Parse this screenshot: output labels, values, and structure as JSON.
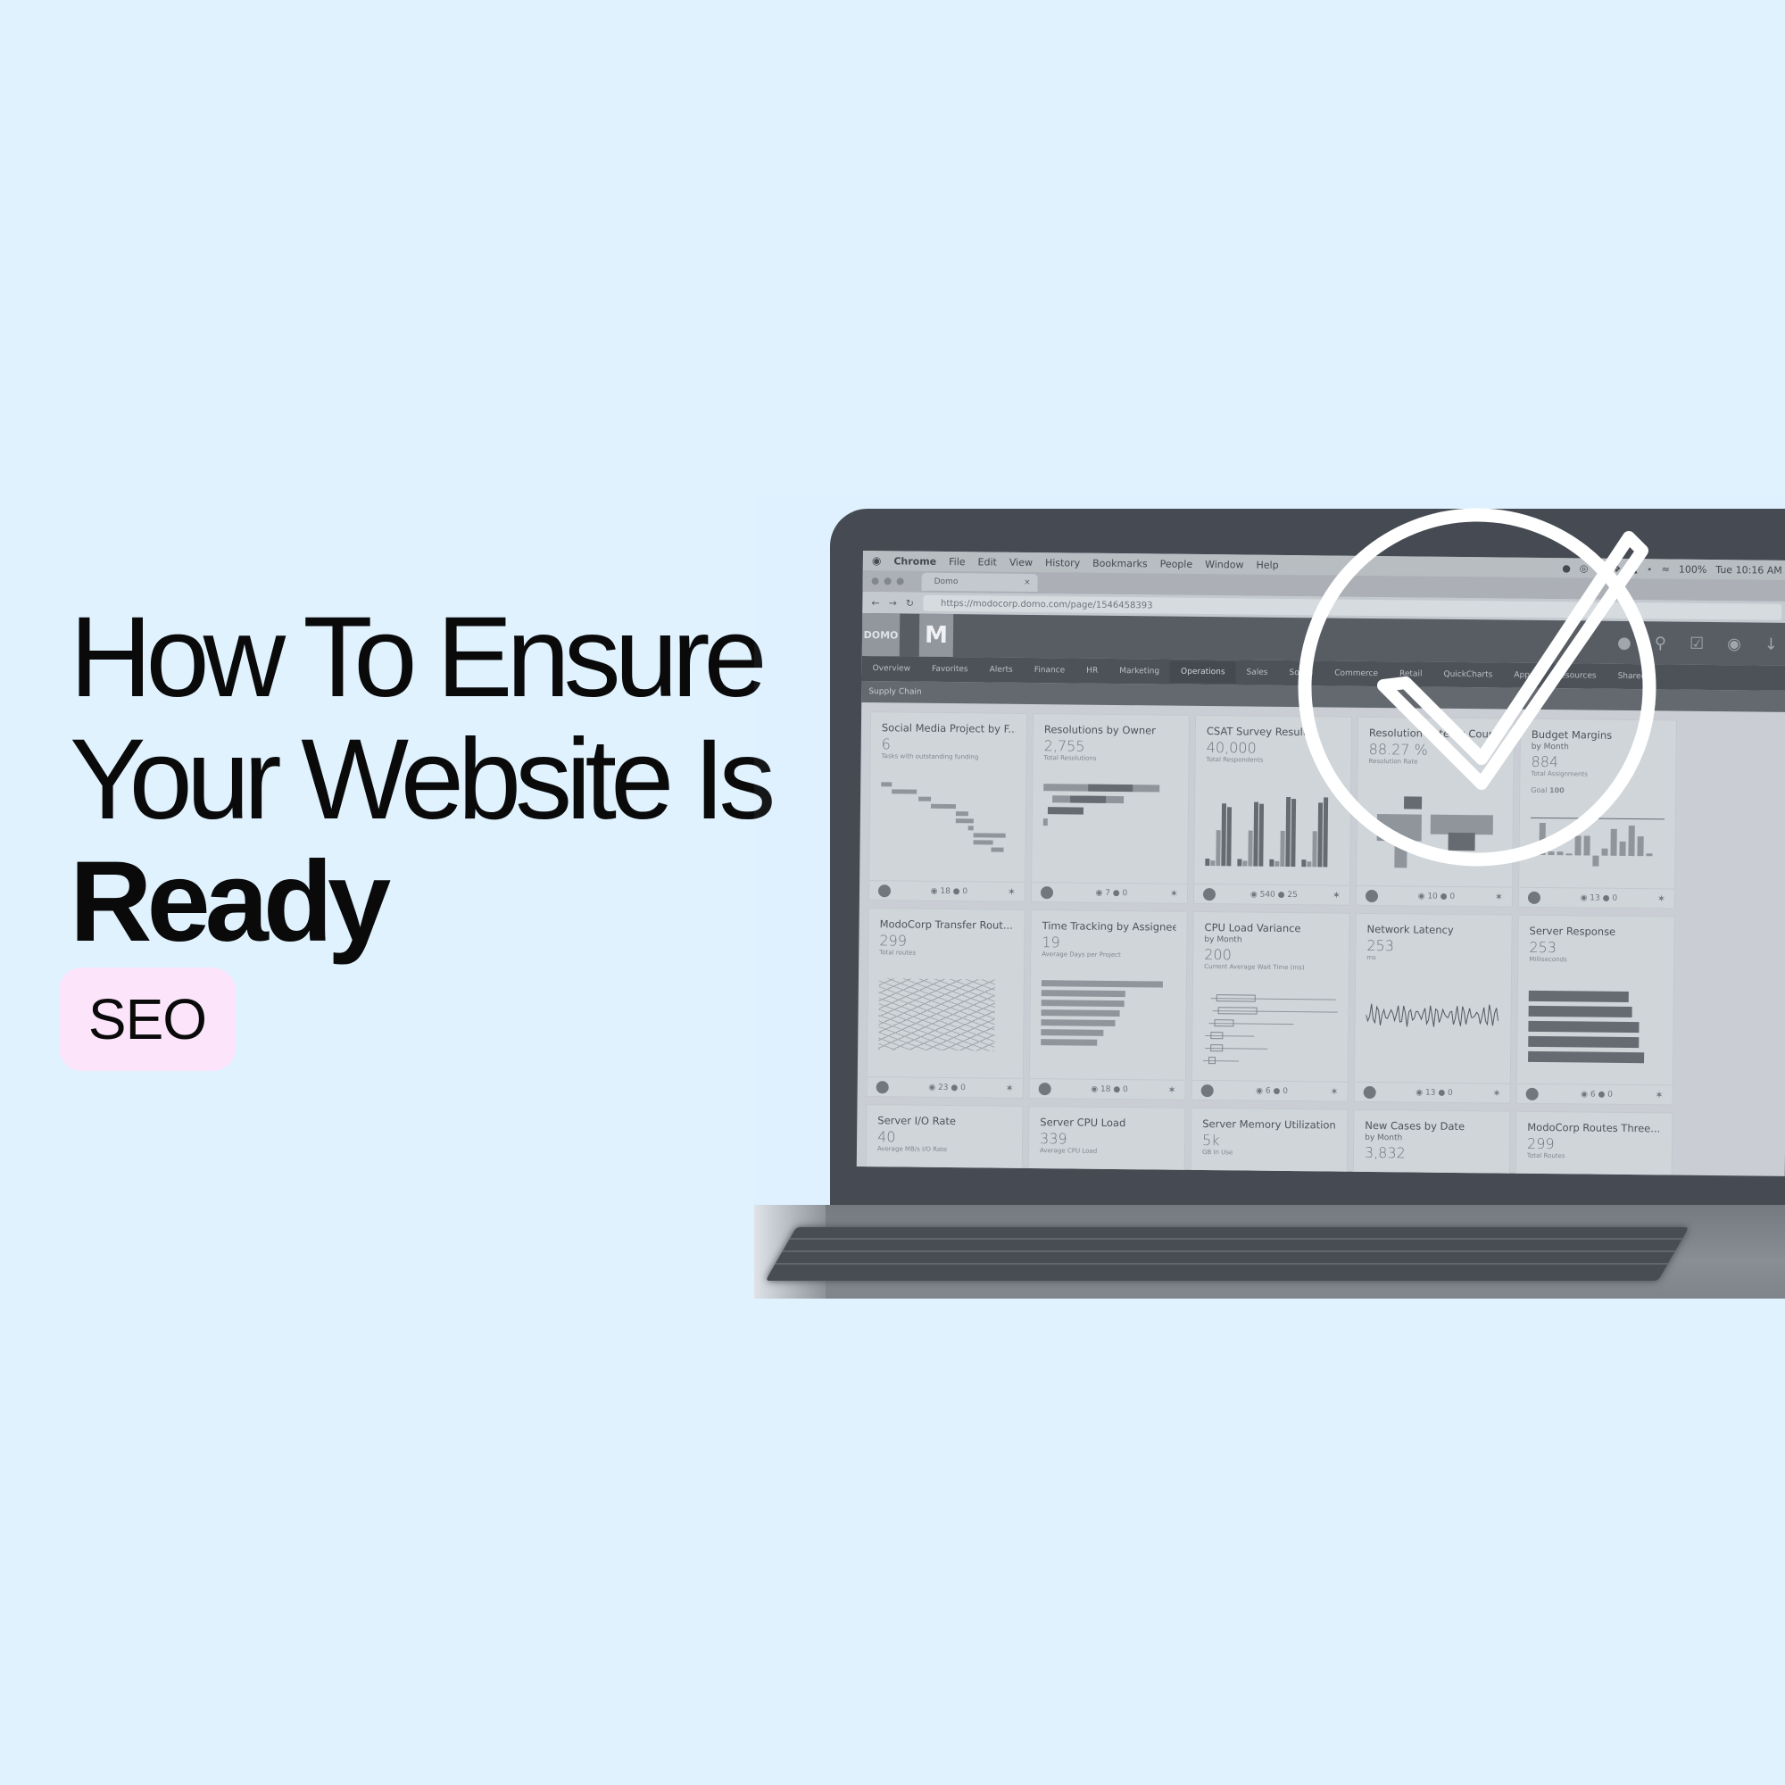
{
  "headline": {
    "line1": "How To Ensure",
    "line2": "Your Website Is",
    "line3": "Ready"
  },
  "badge": {
    "label": "SEO"
  },
  "colors": {
    "background": "#e0f2fe",
    "badge_bg": "#fce4fb",
    "text": "#0a0a0a",
    "check_icon": "#ffffff"
  },
  "overlay_icon": "check-circle-icon",
  "laptop_screen": {
    "menu_bar": {
      "apple": "",
      "app": "Chrome",
      "items": [
        "File",
        "Edit",
        "View",
        "History",
        "Bookmarks",
        "People",
        "Window",
        "Help"
      ],
      "battery": "100%",
      "clock": "Tue 10:16 AM"
    },
    "browser": {
      "tab_title": "Domo",
      "tab_close": "×",
      "url": "https://modocorp.domo.com/page/1546458393"
    },
    "app_header": {
      "logo": "DOMO",
      "page_logo": "M",
      "icons": [
        "globe-icon",
        "search-icon",
        "checkbox-icon",
        "chat-icon",
        "download-icon"
      ]
    },
    "nav": [
      "Overview",
      "Favorites",
      "Alerts",
      "Finance",
      "HR",
      "Marketing",
      "Operations",
      "Sales",
      "Social",
      "Commerce",
      "Retail",
      "QuickCharts",
      "Apps",
      "Resources",
      "Shared"
    ],
    "active_nav": "Operations",
    "subnav": "Supply Chain",
    "cards": [
      {
        "title": "Social Media Project by F...",
        "subtitle": "",
        "value": "6",
        "label": "Tasks with outstanding funding",
        "views": "18",
        "comments": "0",
        "chart": "gantt"
      },
      {
        "title": "Resolutions by Owner",
        "subtitle": "",
        "value": "2,755",
        "label": "Total Resolutions",
        "views": "7",
        "comments": "0",
        "chart": "stacked-bars"
      },
      {
        "title": "CSAT Survey Results",
        "subtitle": "",
        "value": "40,000",
        "label": "Total Respondents",
        "views": "540",
        "comments": "25",
        "chart": "grouped-bars"
      },
      {
        "title": "Resolution Rate by Coun...",
        "subtitle": "",
        "value": "88.27 %",
        "label": "Resolution Rate",
        "views": "10",
        "comments": "0",
        "chart": "world-map"
      },
      {
        "title": "Budget Margins",
        "subtitle": "by Month",
        "value": "884",
        "label": "Total Assignments",
        "goal_label": "Goal",
        "goal_value": "100",
        "views": "13",
        "comments": "0",
        "chart": "bars-with-line"
      },
      {
        "title": "ModoCorp Transfer Rout...",
        "subtitle": "",
        "value": "299",
        "label": "Total routes",
        "views": "23",
        "comments": "0",
        "chart": "route-map"
      },
      {
        "title": "Time Tracking by Assignee",
        "subtitle": "",
        "value": "19",
        "label": "Average Days per Project",
        "views": "18",
        "comments": "0",
        "chart": "hbars"
      },
      {
        "title": "CPU Load Variance",
        "subtitle": "by Month",
        "value": "200",
        "label": "Current Average Wait Time (ms)",
        "views": "6",
        "comments": "0",
        "chart": "boxplot"
      },
      {
        "title": "Network Latency",
        "subtitle": "",
        "value": "253",
        "label": "ms",
        "views": "13",
        "comments": "0",
        "chart": "line"
      },
      {
        "title": "Server Response",
        "subtitle": "",
        "value": "253",
        "label": "Milliseconds",
        "views": "6",
        "comments": "0",
        "chart": "hbars-dark"
      },
      {
        "title": "Server I/O Rate",
        "subtitle": "",
        "value": "40",
        "label": "Average MB/s I/O Rate"
      },
      {
        "title": "Server CPU Load",
        "subtitle": "",
        "value": "339",
        "label": "Average CPU Load"
      },
      {
        "title": "Server Memory Utilization",
        "subtitle": "",
        "value": "5k",
        "label": "GB In Use"
      },
      {
        "title": "New Cases by Date",
        "subtitle": "by Month",
        "value": "3,832",
        "label": ""
      },
      {
        "title": "ModoCorp Routes Three...",
        "subtitle": "",
        "value": "299",
        "label": "Total Routes"
      }
    ]
  }
}
